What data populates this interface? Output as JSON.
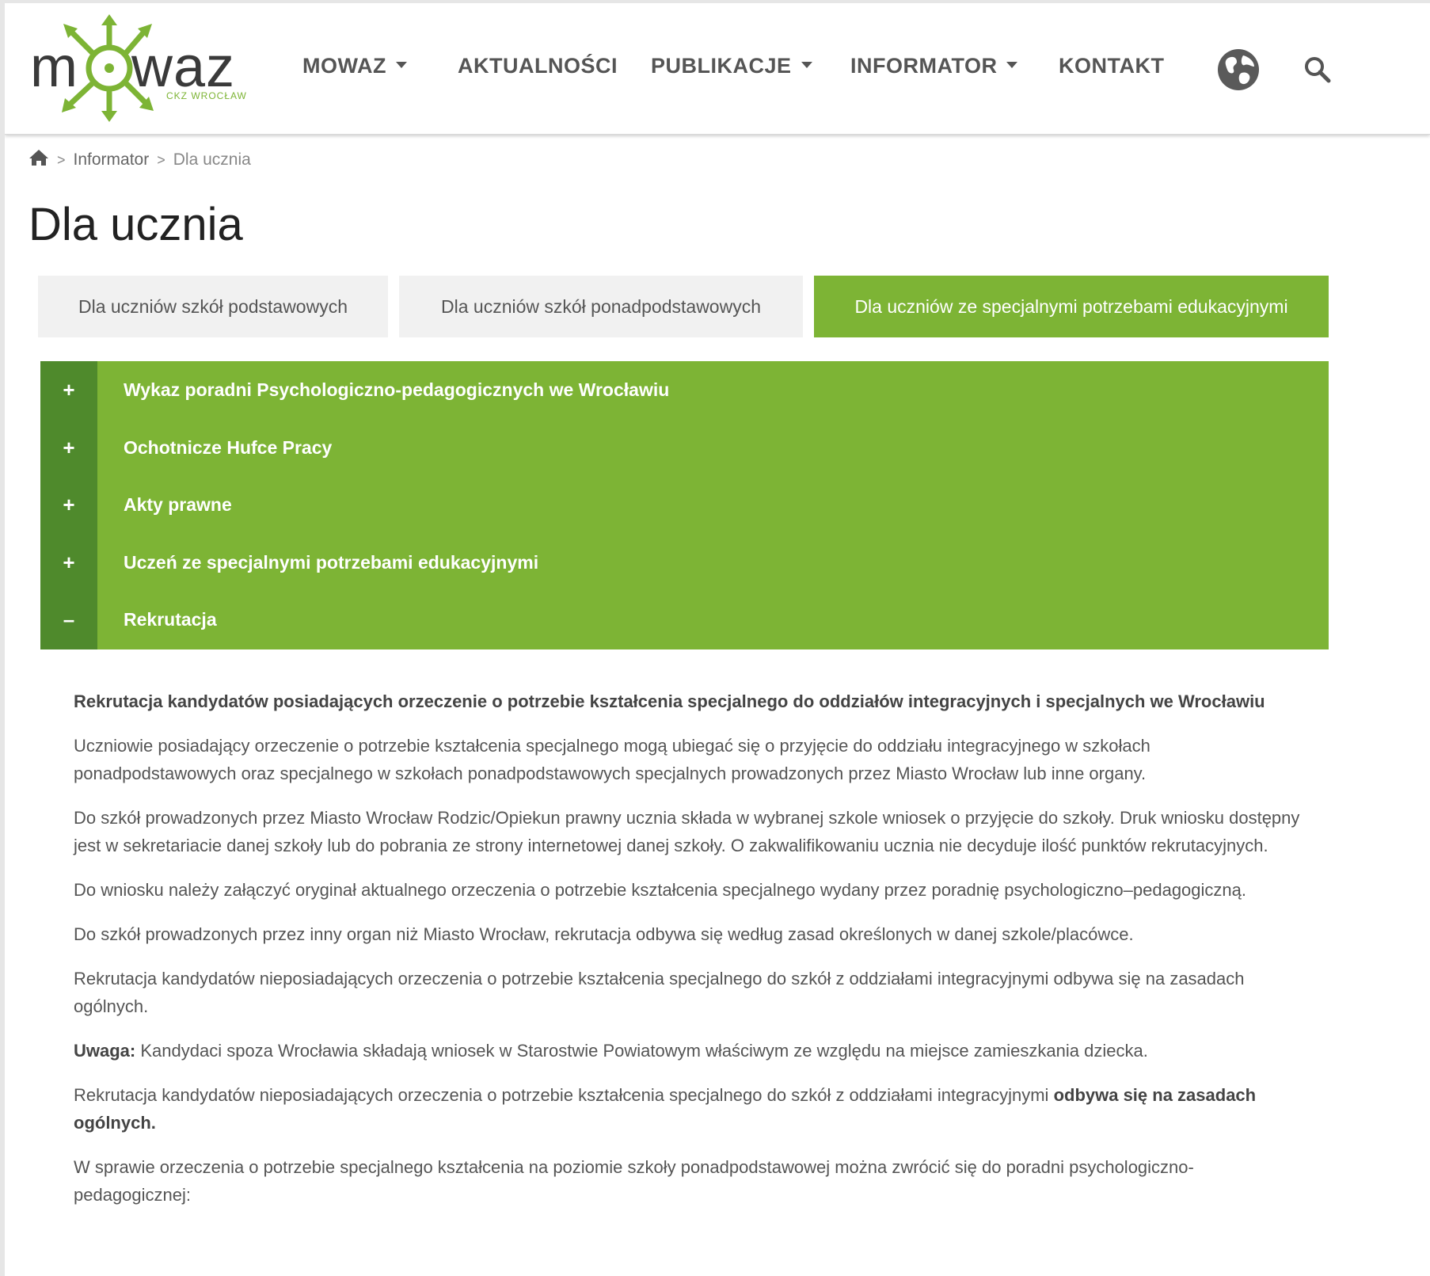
{
  "logo": {
    "left_text": "m",
    "right_text": "waz",
    "sub_text": "CKZ WROCŁAW",
    "accent_color": "#7db435"
  },
  "nav": {
    "items": [
      {
        "label": "MOWAZ",
        "has_dropdown": true
      },
      {
        "label": "AKTUALNOŚCI",
        "has_dropdown": false
      },
      {
        "label": "PUBLIKACJE",
        "has_dropdown": true
      },
      {
        "label": "INFORMATOR",
        "has_dropdown": true
      },
      {
        "label": "KONTAKT",
        "has_dropdown": false
      }
    ],
    "globe_icon": "globe-icon",
    "search_icon": "search-icon"
  },
  "breadcrumb": {
    "home_icon": "home-icon",
    "separator": ">",
    "items": [
      "Informator",
      "Dla ucznia"
    ]
  },
  "page": {
    "title": "Dla ucznia"
  },
  "tabs": [
    {
      "label": "Dla uczniów szkół podstawowych",
      "active": false
    },
    {
      "label": "Dla uczniów szkół ponadpodstawowych",
      "active": false
    },
    {
      "label": "Dla uczniów ze specjalnymi potrzebami edukacyjnymi",
      "active": true
    }
  ],
  "accordion": {
    "items": [
      {
        "toggle": "+",
        "title": "Wykaz poradni Psychologiczno-pedagogicznych we Wrocławiu"
      },
      {
        "toggle": "+",
        "title": "Ochotnicze Hufce Pracy"
      },
      {
        "toggle": "+",
        "title": "Akty prawne"
      },
      {
        "toggle": "+",
        "title": "Uczeń ze specjalnymi potrzebami edukacyjnymi"
      },
      {
        "toggle": "–",
        "title": "Rekrutacja"
      }
    ],
    "colors": {
      "bar": "#7db435",
      "gutter": "#4f8a2c"
    }
  },
  "content": {
    "heading": "Rekrutacja kandydatów posiadających orzeczenie o potrzebie kształcenia specjalnego do oddziałów integracyjnych i specjalnych we Wrocławiu",
    "p1": "Uczniowie posiadający orzeczenie o potrzebie kształcenia specjalnego mogą ubiegać się o przyjęcie do oddziału integracyjnego w szkołach ponadpodstawowych oraz specjalnego w szkołach ponadpodstawowych specjalnych prowadzonych przez Miasto Wrocław lub inne organy.",
    "p2": "Do szkół prowadzonych przez Miasto Wrocław Rodzic/Opiekun prawny ucznia  składa w wybranej szkole wniosek o przyjęcie do szkoły. Druk wniosku dostępny jest w sekretariacie danej szkoły lub do pobrania ze strony internetowej danej szkoły. O zakwalifikowaniu ucznia nie decyduje ilość punktów rekrutacyjnych.",
    "p3": "Do wniosku należy załączyć oryginał aktualnego orzeczenia o potrzebie kształcenia specjalnego wydany przez poradnię psychologiczno–pedagogiczną.",
    "p4": "Do szkół prowadzonych przez inny organ niż Miasto Wrocław, rekrutacja odbywa się według zasad określonych w danej szkole/placówce.",
    "p5": "Rekrutacja kandydatów nieposiadających orzeczenia o potrzebie kształcenia specjalnego do szkół z oddziałami integracyjnymi odbywa się na zasadach ogólnych.",
    "p6_label": "Uwaga:",
    "p6_text": " Kandydaci spoza Wrocławia składają wniosek w Starostwie Powiatowym właściwym ze względu na miejsce zamieszkania dziecka.",
    "p7_text": "Rekrutacja kandydatów nieposiadających orzeczenia o potrzebie kształcenia specjalnego do szkół z oddziałami integracyjnymi ",
    "p7_bold": "odbywa się na zasadach ogólnych.",
    "p8": "W sprawie orzeczenia o potrzebie specjalnego kształcenia na poziomie szkoły ponadpodstawowej można zwrócić się do poradni psychologiczno-pedagogicznej:"
  }
}
